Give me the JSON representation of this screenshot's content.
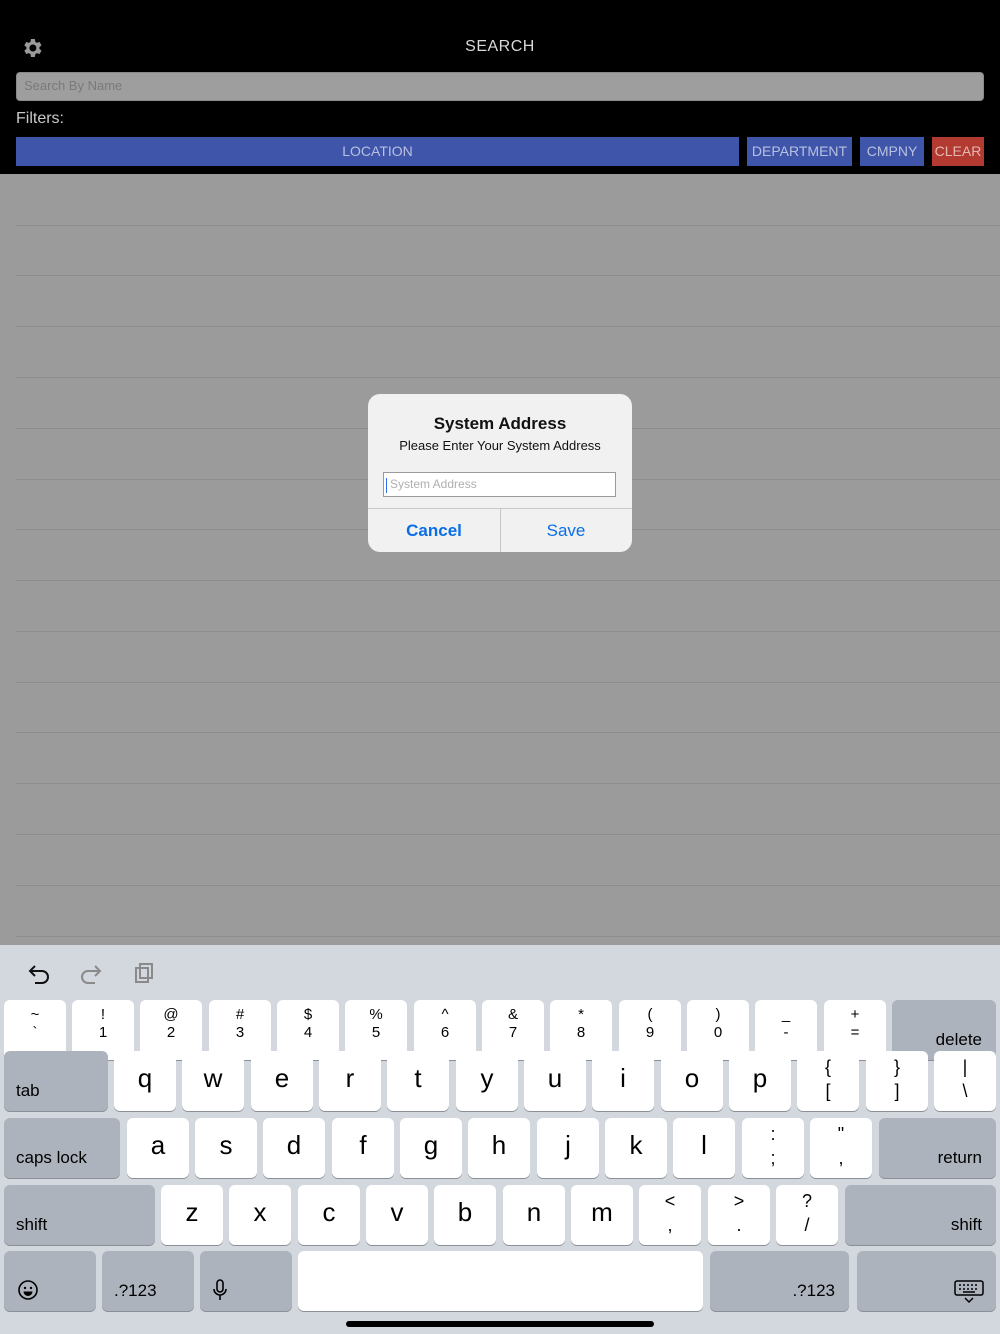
{
  "header": {
    "settings_icon": "gear-icon",
    "title": "SEARCH",
    "search_placeholder": "Search By Name",
    "filters_label": "Filters:",
    "filter_buttons": [
      "LOCATION",
      "DEPARTMENT",
      "CMPNY",
      "CLEAR"
    ],
    "colors": {
      "filter_blue": "#3f55aa",
      "clear_red": "#b23a30"
    }
  },
  "dialog": {
    "title": "System Address",
    "message": "Please Enter Your System Address",
    "input_placeholder": "System Address",
    "cancel_label": "Cancel",
    "save_label": "Save",
    "button_color": "#0a6ee6"
  },
  "keyboard": {
    "toolbar_icons": [
      "undo-icon",
      "redo-icon",
      "paste-icon"
    ],
    "row_numbers": [
      {
        "top": "~",
        "bottom": "`"
      },
      {
        "top": "!",
        "bottom": "1"
      },
      {
        "top": "@",
        "bottom": "2"
      },
      {
        "top": "#",
        "bottom": "3"
      },
      {
        "top": "$",
        "bottom": "4"
      },
      {
        "top": "%",
        "bottom": "5"
      },
      {
        "top": "^",
        "bottom": "6"
      },
      {
        "top": "&",
        "bottom": "7"
      },
      {
        "top": "*",
        "bottom": "8"
      },
      {
        "top": "(",
        "bottom": "9"
      },
      {
        "top": ")",
        "bottom": "0"
      },
      {
        "top": "_",
        "bottom": "-"
      },
      {
        "top": "+",
        "bottom": "="
      }
    ],
    "delete": "delete",
    "tab": "tab",
    "row_q": [
      "q",
      "w",
      "e",
      "r",
      "t",
      "y",
      "u",
      "i",
      "o",
      "p"
    ],
    "row_q_symbols": [
      {
        "top": "{",
        "bottom": "["
      },
      {
        "top": "}",
        "bottom": "]"
      },
      {
        "top": "|",
        "bottom": "\\"
      }
    ],
    "caps_lock": "caps lock",
    "row_a": [
      "a",
      "s",
      "d",
      "f",
      "g",
      "h",
      "j",
      "k",
      "l"
    ],
    "row_a_symbols": [
      {
        "top": ":",
        "bottom": ";"
      },
      {
        "top": "\"",
        "bottom": ","
      }
    ],
    "return": "return",
    "shift": "shift",
    "row_z": [
      "z",
      "x",
      "c",
      "v",
      "b",
      "n",
      "m"
    ],
    "row_z_symbols": [
      {
        "top": "<",
        "bottom": ","
      },
      {
        "top": ">",
        "bottom": "."
      },
      {
        "top": "?",
        "bottom": "/"
      }
    ],
    "emoji_icon": "emoji-icon",
    "numbers_toggle": ".?123",
    "mic_icon": "microphone-icon",
    "dismiss_icon": "keyboard-dismiss-icon"
  }
}
